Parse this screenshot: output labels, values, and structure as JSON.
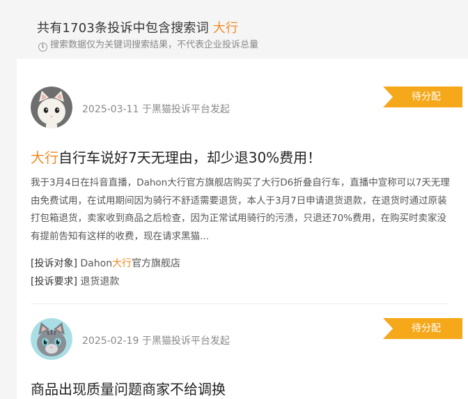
{
  "summary": {
    "title_prefix": "共有1703条投诉中包含搜索词",
    "keyword": "大行",
    "note": "搜索数据仅为关键词搜索结果，不代表企业投诉总量",
    "info_icon": "info-icon"
  },
  "complaints": [
    {
      "date": "2025-03-11",
      "source": "于黑猫投诉平台发起",
      "status": "待分配",
      "title_keyword": "大行",
      "title_rest": "自行车说好7天无理由，却少退30%费用！",
      "description": "我于3月4日在抖音直播，Dahon大行官方旗舰店购买了大行D6折叠自行车，直播中宣称可以7天无理由免费试用，在试用期间因为骑行不舒适需要退货，本人于3月7日申请退货退款，在退货时通过原装打包箱退货，卖家收到商品之后检查，因为正常试用骑行的污渍，只退还70%费用，在购买时卖家没有提前告知有这样的收费，现在请求黑猫...",
      "target_label": "[投诉对象]",
      "target_pre": "Dahon",
      "target_kw": "大行",
      "target_post": "官方旗舰店",
      "demand_label": "[投诉要求]",
      "demand_value": "退货退款",
      "avatar": "white-cat-avatar"
    },
    {
      "date": "2025-02-19",
      "source": "于黑猫投诉平台发起",
      "status": "待分配",
      "title": "商品出现质量问题商家不给调换",
      "avatar": "gray-cat-avatar"
    }
  ],
  "colors": {
    "accent": "#f08a24",
    "status_badge": "#f6a81b"
  }
}
